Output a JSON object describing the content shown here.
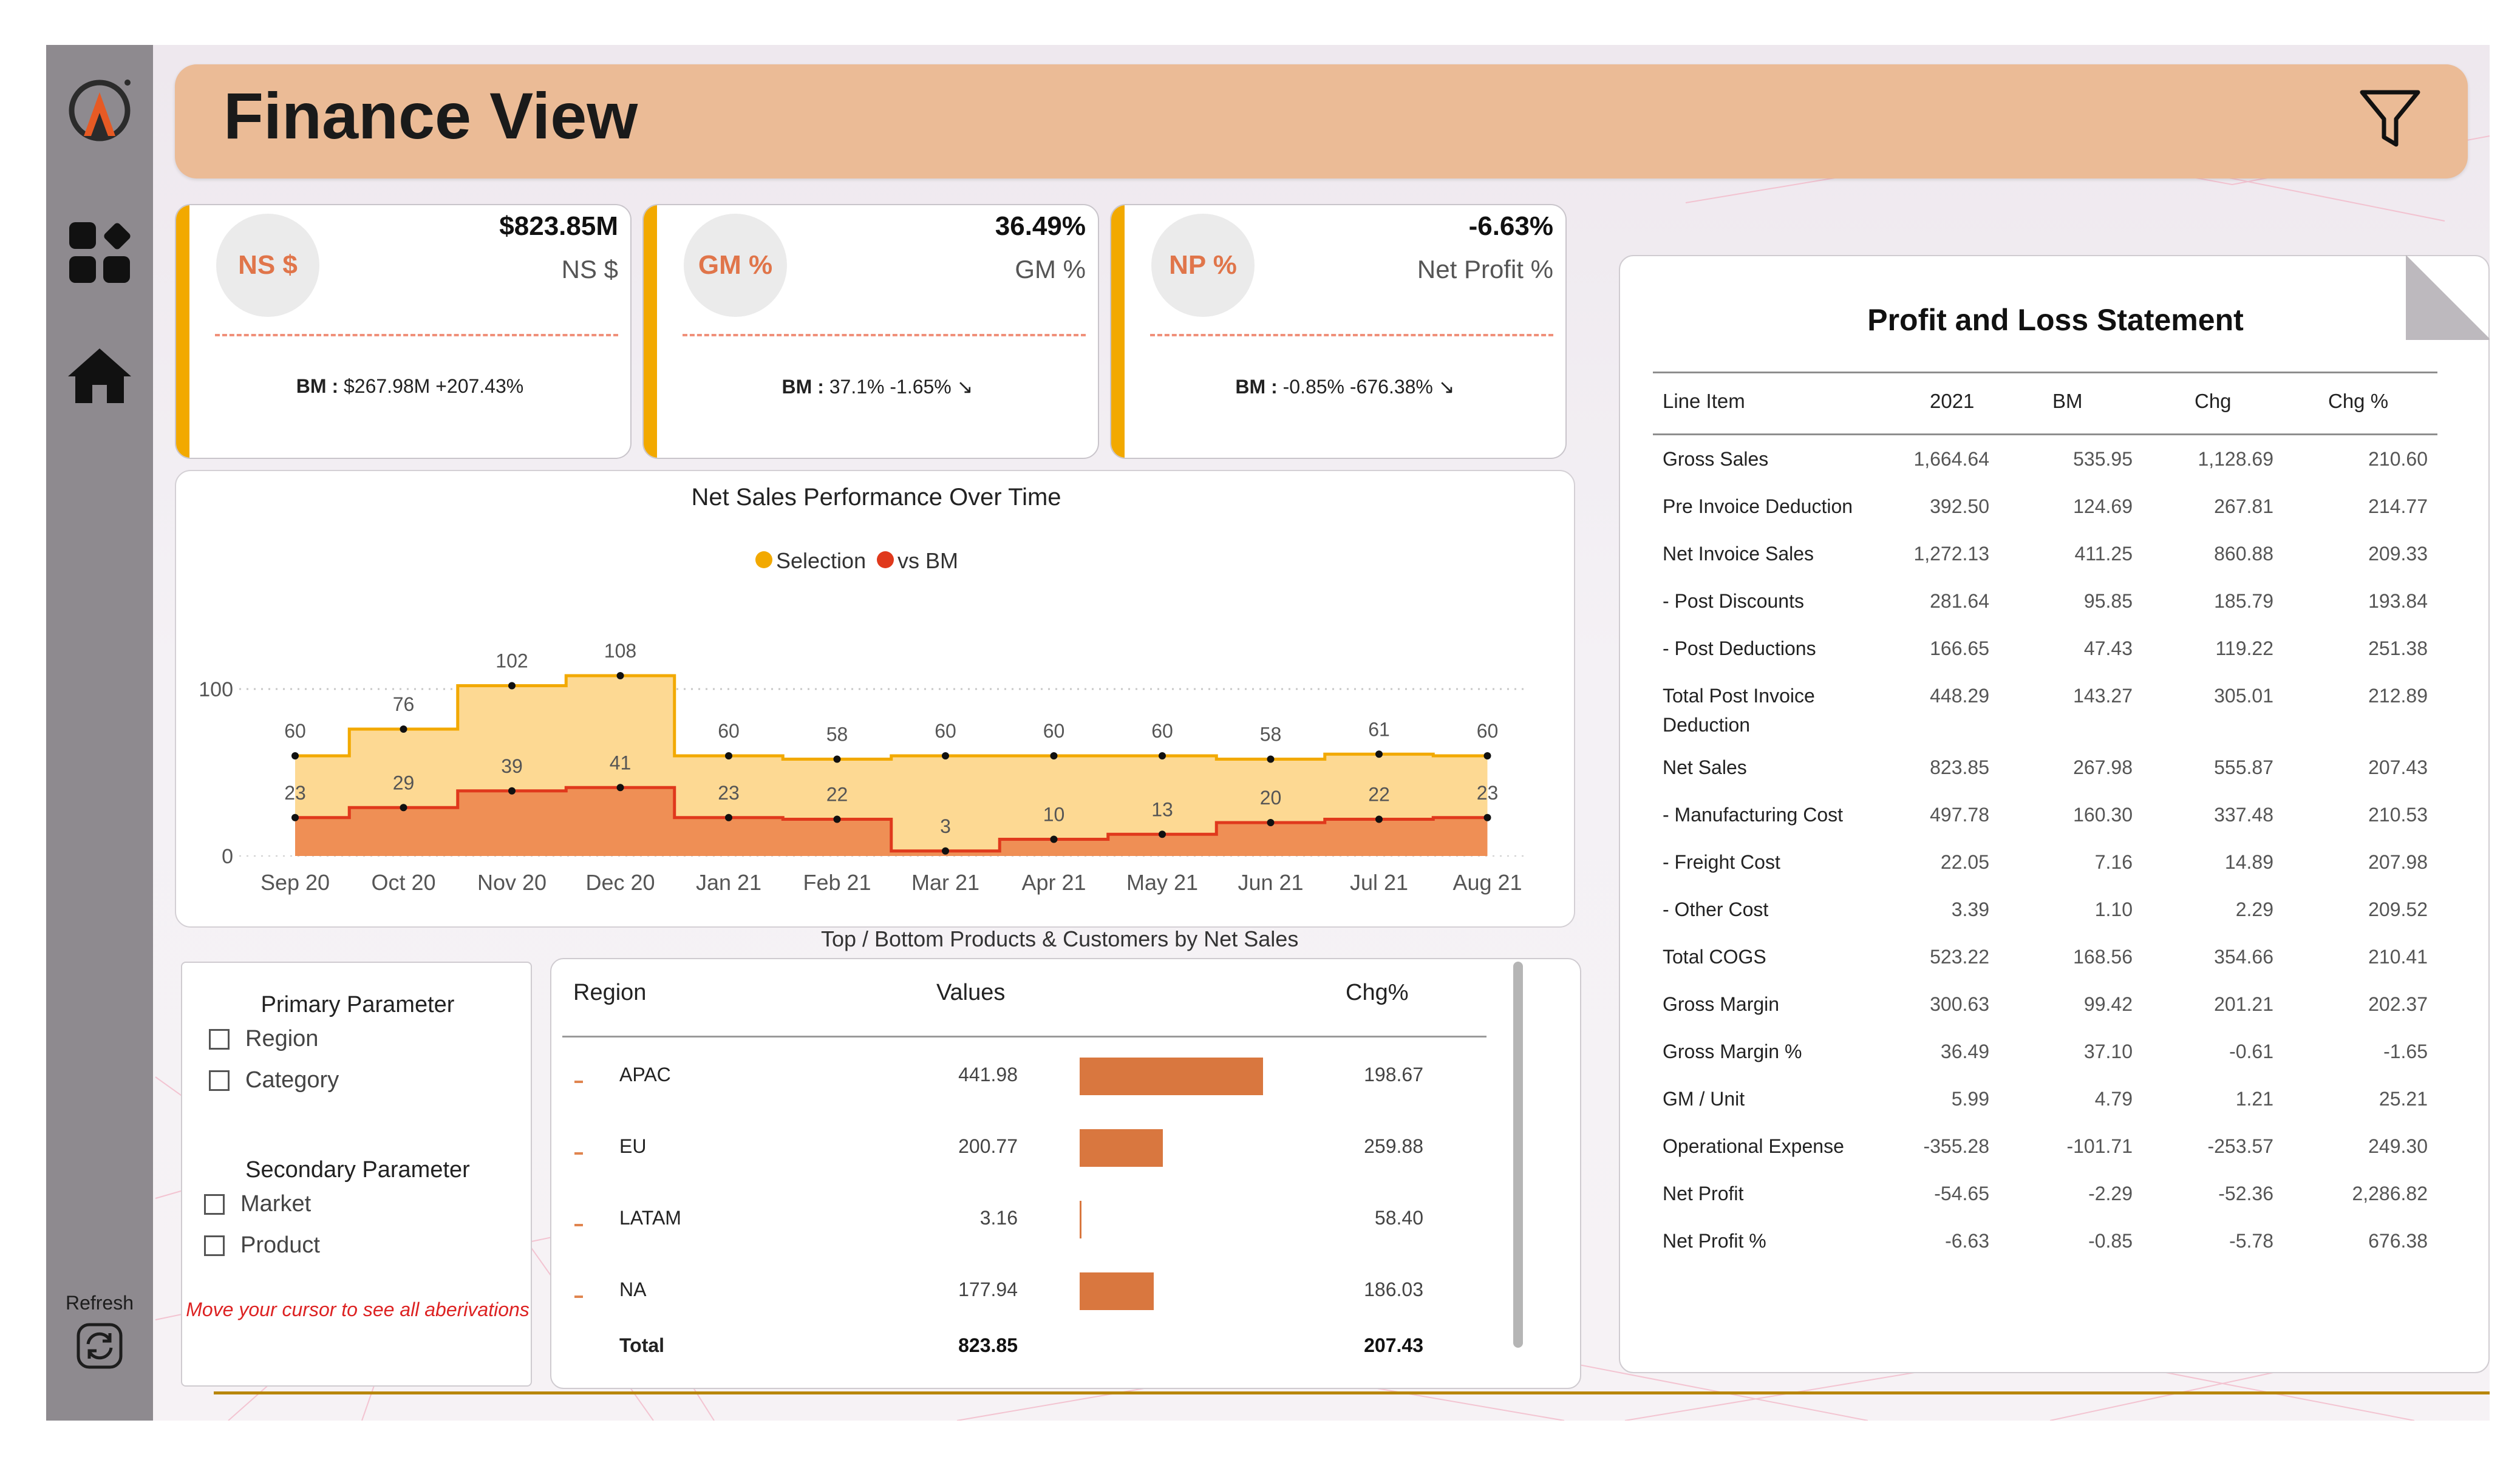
{
  "app": {
    "title": "Finance View"
  },
  "sidebar": {
    "refresh_label": "Refresh"
  },
  "kpis": [
    {
      "badge": "NS $",
      "value": "$823.85M",
      "caption": "NS $",
      "bm_label": "BM :",
      "bm_text": "$267.98M +207.43%",
      "trend": ""
    },
    {
      "badge": "GM %",
      "value": "36.49%",
      "caption": "GM %",
      "bm_label": "BM :",
      "bm_text": "37.1% -1.65% ",
      "trend": "↘"
    },
    {
      "badge": "NP %",
      "value": "-6.63%",
      "caption": "Net Profit %",
      "bm_label": "BM :",
      "bm_text": "-0.85% -676.38% ",
      "trend": "↘"
    }
  ],
  "colors": {
    "selection": "#f2a900",
    "selection_fill": "#fdd993",
    "bm": "#e0391c",
    "bm_fill": "#ef8f55",
    "accent": "#f2a900",
    "header": "#ebbb96"
  },
  "chart_data": {
    "type": "area",
    "title": "Net Sales Performance Over Time",
    "legend": [
      "Selection",
      "vs BM"
    ],
    "legend_position": "top-center",
    "categories": [
      "Sep 20",
      "Oct 20",
      "Nov 20",
      "Dec 20",
      "Jan 21",
      "Feb 21",
      "Mar 21",
      "Apr 21",
      "May 21",
      "Jun 21",
      "Jul 21",
      "Aug 21"
    ],
    "series": [
      {
        "name": "Selection",
        "values": [
          60,
          76,
          102,
          108,
          60,
          58,
          60,
          60,
          60,
          58,
          61,
          60
        ]
      },
      {
        "name": "vs BM",
        "values": [
          23,
          29,
          39,
          41,
          23,
          22,
          3,
          10,
          13,
          20,
          22,
          23
        ]
      }
    ],
    "yticks": [
      0,
      100
    ],
    "ylim": [
      0,
      120
    ],
    "step": true,
    "grid": "dotted-horizontal"
  },
  "section_label": "Top / Bottom Products & Customers by Net Sales",
  "slicer": {
    "primary_title": "Primary Parameter",
    "primary_options": [
      "Region",
      "Category"
    ],
    "secondary_title": "Secondary Parameter",
    "secondary_options": [
      "Market",
      "Product"
    ],
    "hint": "Move your cursor to see all aberivations"
  },
  "region_table": {
    "headers": [
      "Region",
      "Values",
      "Chg%"
    ],
    "rows": [
      {
        "region": "APAC",
        "value": "441.98",
        "bar_value": 441.98,
        "chg": "198.67"
      },
      {
        "region": "EU",
        "value": "200.77",
        "bar_value": 200.77,
        "chg": "259.88"
      },
      {
        "region": "LATAM",
        "value": "3.16",
        "bar_value": 3.16,
        "chg": "58.40"
      },
      {
        "region": "NA",
        "value": "177.94",
        "bar_value": 177.94,
        "chg": "186.03"
      }
    ],
    "total": {
      "label": "Total",
      "value": "823.85",
      "chg": "207.43"
    },
    "bar_max": 441.98
  },
  "pl": {
    "title": "Profit and Loss Statement",
    "headers": [
      "Line Item",
      "2021",
      "BM",
      "Chg",
      "Chg %"
    ],
    "rows": [
      {
        "item": "Gross Sales",
        "v2021": "1,664.64",
        "bm": "535.95",
        "chg": "1,128.69",
        "chgp": "210.60"
      },
      {
        "item": "Pre Invoice Deduction",
        "v2021": "392.50",
        "bm": "124.69",
        "chg": "267.81",
        "chgp": "214.77"
      },
      {
        "item": "Net Invoice Sales",
        "v2021": "1,272.13",
        "bm": "411.25",
        "chg": "860.88",
        "chgp": "209.33"
      },
      {
        "item": "- Post Discounts",
        "v2021": "281.64",
        "bm": "95.85",
        "chg": "185.79",
        "chgp": "193.84"
      },
      {
        "item": "- Post Deductions",
        "v2021": "166.65",
        "bm": "47.43",
        "chg": "119.22",
        "chgp": "251.38"
      },
      {
        "item": "Total Post Invoice Deduction",
        "v2021": "448.29",
        "bm": "143.27",
        "chg": "305.01",
        "chgp": "212.89"
      },
      {
        "item": "Net Sales",
        "v2021": "823.85",
        "bm": "267.98",
        "chg": "555.87",
        "chgp": "207.43"
      },
      {
        "item": "- Manufacturing Cost",
        "v2021": "497.78",
        "bm": "160.30",
        "chg": "337.48",
        "chgp": "210.53"
      },
      {
        "item": "- Freight Cost",
        "v2021": "22.05",
        "bm": "7.16",
        "chg": "14.89",
        "chgp": "207.98"
      },
      {
        "item": "- Other Cost",
        "v2021": "3.39",
        "bm": "1.10",
        "chg": "2.29",
        "chgp": "209.52"
      },
      {
        "item": "Total COGS",
        "v2021": "523.22",
        "bm": "168.56",
        "chg": "354.66",
        "chgp": "210.41"
      },
      {
        "item": "Gross Margin",
        "v2021": "300.63",
        "bm": "99.42",
        "chg": "201.21",
        "chgp": "202.37"
      },
      {
        "item": "Gross Margin %",
        "v2021": "36.49",
        "bm": "37.10",
        "chg": "-0.61",
        "chgp": "-1.65"
      },
      {
        "item": "GM / Unit",
        "v2021": "5.99",
        "bm": "4.79",
        "chg": "1.21",
        "chgp": "25.21"
      },
      {
        "item": "Operational Expense",
        "v2021": "-355.28",
        "bm": "-101.71",
        "chg": "-253.57",
        "chgp": "249.30"
      },
      {
        "item": "Net Profit",
        "v2021": "-54.65",
        "bm": "-2.29",
        "chg": "-52.36",
        "chgp": "2,286.82"
      },
      {
        "item": "Net Profit %",
        "v2021": "-6.63",
        "bm": "-0.85",
        "chg": "-5.78",
        "chgp": "676.38"
      }
    ]
  }
}
